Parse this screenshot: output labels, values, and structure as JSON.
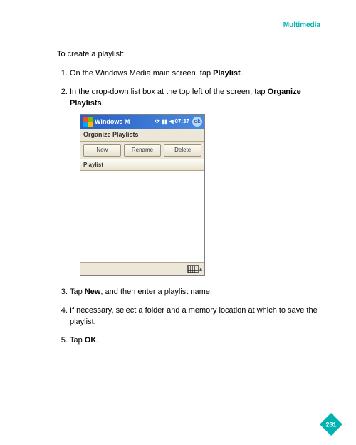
{
  "header": "Multimedia",
  "intro": "To create a playlist:",
  "steps": [
    {
      "pre": "On the Windows Media main screen, tap ",
      "bold": "Playlist",
      "post": "."
    },
    {
      "pre": "In the drop-down list box at the top left of the screen, tap ",
      "bold": "Organize Playlists",
      "post": "."
    },
    {
      "pre": "Tap ",
      "bold": "New",
      "post": ", and then enter a playlist name."
    },
    {
      "pre": "If necessary, select a folder and a memory location at which to save the playlist.",
      "bold": "",
      "post": ""
    },
    {
      "pre": "Tap ",
      "bold": "OK",
      "post": "."
    }
  ],
  "screenshot": {
    "title": "Windows M",
    "time": "07:37",
    "ok": "ok",
    "subtitle": "Organize Playlists",
    "buttons": [
      "New",
      "Rename",
      "Delete"
    ],
    "listHeader": "Playlist"
  },
  "pageNumber": "231"
}
